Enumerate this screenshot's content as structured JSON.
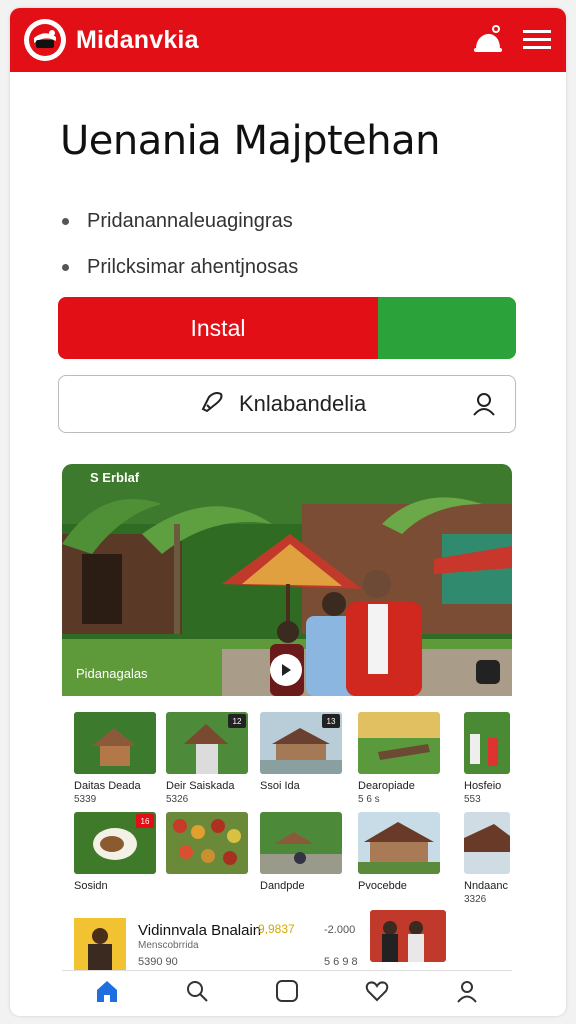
{
  "app": {
    "title": "Midanvkia",
    "brand_color": "#e20f16"
  },
  "header": {
    "icons": [
      "logo-icon",
      "notification-icon",
      "menu-icon"
    ]
  },
  "main": {
    "heading": "Uenania Majptehan",
    "bullets": [
      "Pridanannaleuagingras",
      "Prilcksimar ahentjnosas"
    ],
    "install_label": "Instal",
    "install_colors": {
      "left": "#e20f16",
      "right": "#2ba33a"
    },
    "search": {
      "value": "Knlabandelia"
    }
  },
  "hero": {
    "status": "S Erblaf",
    "caption": "Pidanagalas"
  },
  "tiles": [
    {
      "label": "Daitas Deada",
      "num": "5339",
      "badge": ""
    },
    {
      "label": "Deir Saiskada",
      "num": "5326",
      "badge": "12"
    },
    {
      "label": "Ssoi Ida",
      "num": "",
      "badge": "13"
    },
    {
      "label": "Dearopiade",
      "num": "5 6 s",
      "badge": ""
    },
    {
      "label": "Hosfeio",
      "num": "553",
      "badge": ""
    },
    {
      "label": "Sosidn",
      "num": "",
      "badge": "16"
    },
    {
      "label": "",
      "num": "",
      "badge": ""
    },
    {
      "label": "Dandpde",
      "num": "",
      "badge": ""
    },
    {
      "label": "Pvocebde",
      "num": "",
      "badge": ""
    },
    {
      "label": "Nndaanc",
      "num": "3326",
      "badge": ""
    }
  ],
  "feature": {
    "title": "Vidinnvala Bnalain",
    "score": "9,9837",
    "tag": "-2.000",
    "sub": "Menscobrrida",
    "meta": "5390 90",
    "meta2": "5 6 9 8"
  },
  "tabs": [
    "home-icon",
    "search-icon",
    "square-icon",
    "heart-icon",
    "profile-icon"
  ]
}
